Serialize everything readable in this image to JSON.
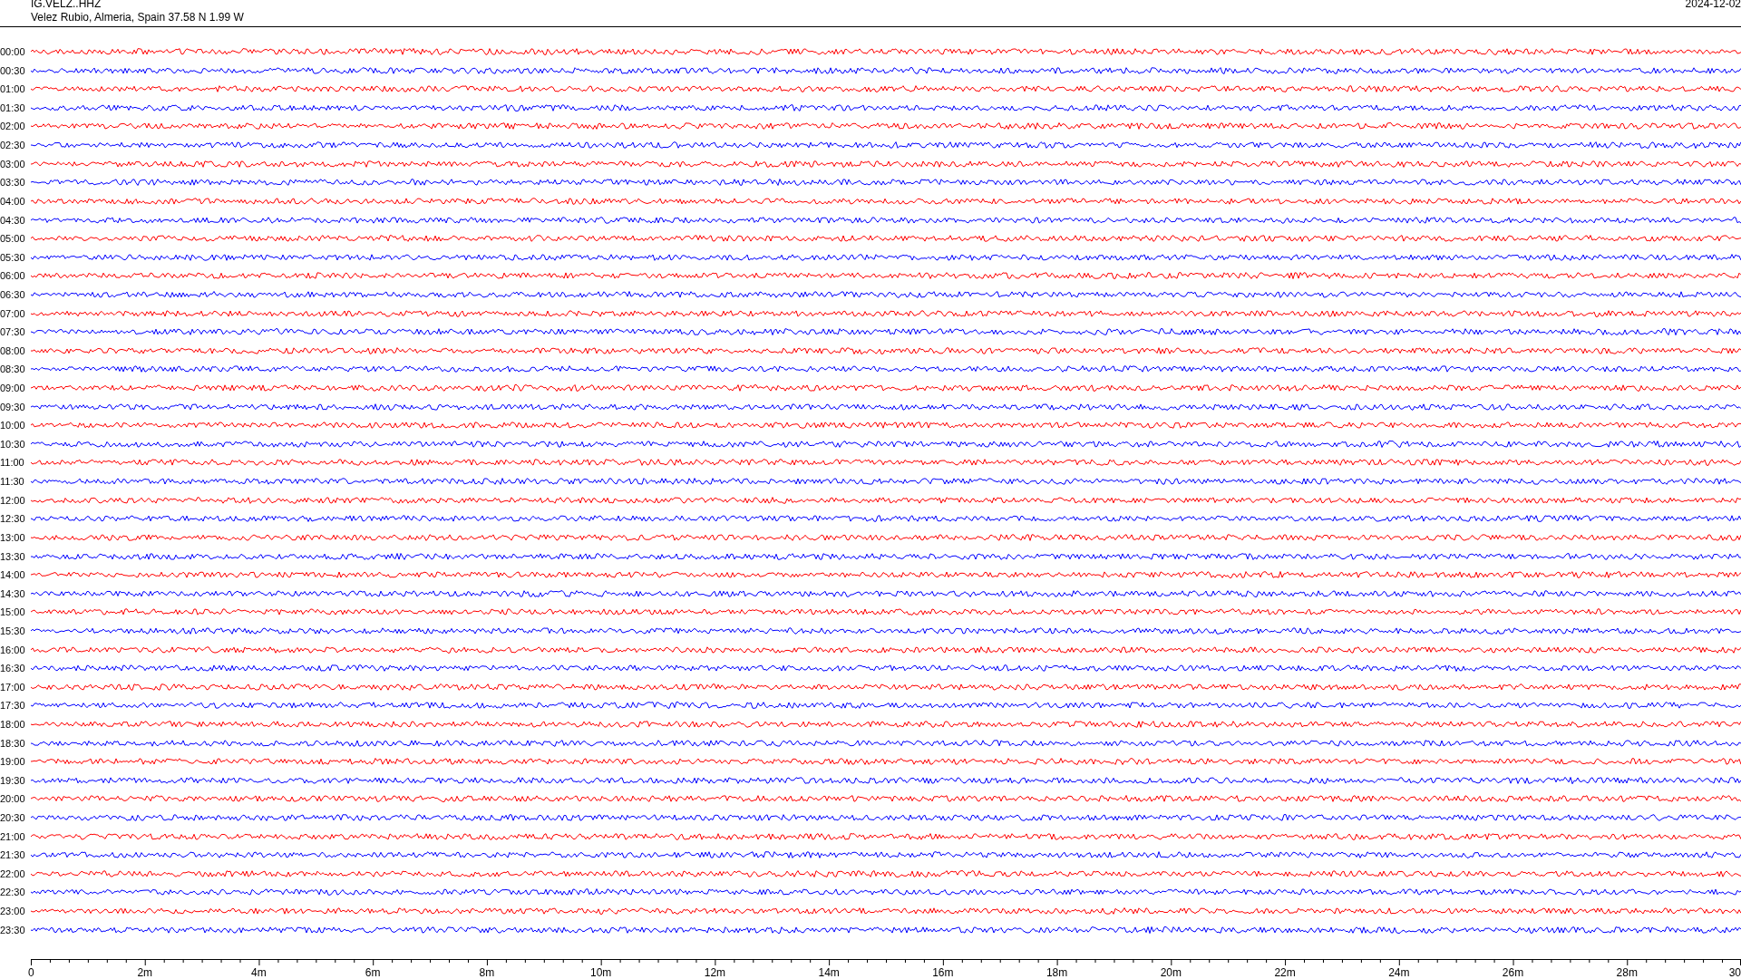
{
  "header": {
    "station": "IG.VELZ..HHZ",
    "location": "Velez Rubio, Almeria, Spain  37.58 N 1.99 W",
    "date": "2024-12-02"
  },
  "rows": [
    {
      "time": "00:00",
      "color": "#ff0000"
    },
    {
      "time": "00:30",
      "color": "#0000ff"
    },
    {
      "time": "01:00",
      "color": "#ff0000"
    },
    {
      "time": "01:30",
      "color": "#0000ff"
    },
    {
      "time": "02:00",
      "color": "#ff0000"
    },
    {
      "time": "02:30",
      "color": "#0000ff"
    },
    {
      "time": "03:00",
      "color": "#ff0000"
    },
    {
      "time": "03:30",
      "color": "#0000ff"
    },
    {
      "time": "04:00",
      "color": "#ff0000"
    },
    {
      "time": "04:30",
      "color": "#0000ff"
    },
    {
      "time": "05:00",
      "color": "#ff0000"
    },
    {
      "time": "05:30",
      "color": "#0000ff"
    },
    {
      "time": "06:00",
      "color": "#ff0000"
    },
    {
      "time": "06:30",
      "color": "#0000ff"
    },
    {
      "time": "07:00",
      "color": "#ff0000"
    },
    {
      "time": "07:30",
      "color": "#0000ff"
    },
    {
      "time": "08:00",
      "color": "#ff0000"
    },
    {
      "time": "08:30",
      "color": "#0000ff"
    },
    {
      "time": "09:00",
      "color": "#ff0000"
    },
    {
      "time": "09:30",
      "color": "#0000ff"
    },
    {
      "time": "10:00",
      "color": "#ff0000"
    },
    {
      "time": "10:30",
      "color": "#0000ff"
    },
    {
      "time": "11:00",
      "color": "#ff0000"
    },
    {
      "time": "11:30",
      "color": "#0000ff"
    },
    {
      "time": "12:00",
      "color": "#ff0000"
    },
    {
      "time": "12:30",
      "color": "#0000ff"
    },
    {
      "time": "13:00",
      "color": "#ff0000"
    },
    {
      "time": "13:30",
      "color": "#0000ff"
    },
    {
      "time": "14:00",
      "color": "#ff0000"
    },
    {
      "time": "14:30",
      "color": "#0000ff"
    },
    {
      "time": "15:00",
      "color": "#ff0000"
    },
    {
      "time": "15:30",
      "color": "#0000ff"
    },
    {
      "time": "16:00",
      "color": "#ff0000"
    },
    {
      "time": "16:30",
      "color": "#0000ff"
    },
    {
      "time": "17:00",
      "color": "#ff0000"
    },
    {
      "time": "17:30",
      "color": "#0000ff"
    },
    {
      "time": "18:00",
      "color": "#ff0000"
    },
    {
      "time": "18:30",
      "color": "#0000ff"
    },
    {
      "time": "19:00",
      "color": "#ff0000"
    },
    {
      "time": "19:30",
      "color": "#0000ff"
    },
    {
      "time": "20:00",
      "color": "#ff0000"
    },
    {
      "time": "20:30",
      "color": "#0000ff"
    },
    {
      "time": "21:00",
      "color": "#ff0000"
    },
    {
      "time": "21:30",
      "color": "#0000ff"
    },
    {
      "time": "22:00",
      "color": "#ff0000"
    },
    {
      "time": "22:30",
      "color": "#0000ff"
    },
    {
      "time": "23:00",
      "color": "#ff0000"
    },
    {
      "time": "23:30",
      "color": "#0000ff"
    }
  ],
  "axis_labels": [
    "0",
    "2m",
    "4m",
    "6m",
    "8m",
    "10m",
    "12m",
    "14m",
    "16m",
    "18m",
    "20m",
    "22m",
    "24m",
    "26m",
    "28m",
    "30"
  ]
}
